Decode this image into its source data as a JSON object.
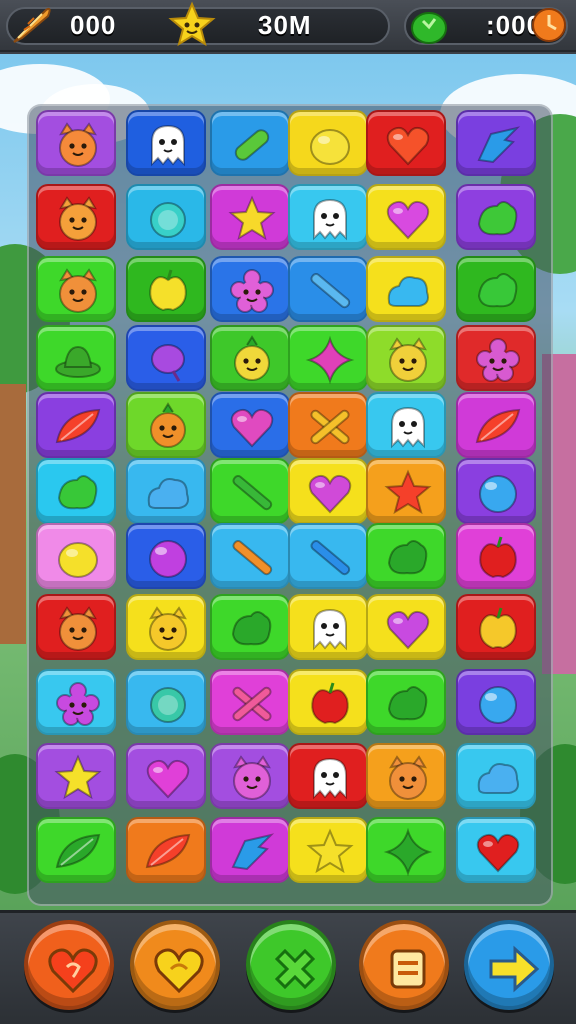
{
  "hud": {
    "left_counter": "000",
    "middle_counter": "30M",
    "right_counter": ":000",
    "icons": [
      "feather-icon",
      "star-icon",
      "green-gem-icon",
      "orange-clock-icon"
    ]
  },
  "board": {
    "rows": 11,
    "cols": 6,
    "tiles": [
      [
        {
          "bg": "#a34ee0",
          "icon": "cat-face",
          "color": "#f58a3a"
        },
        {
          "bg": "#1f5fe0",
          "icon": "ghost",
          "color": "#ffffff"
        },
        {
          "bg": "#2a9be8",
          "icon": "pickle",
          "color": "#5ac83a"
        },
        {
          "bg": "#f5d81c",
          "icon": "lemon",
          "color": "#f6e23a"
        },
        {
          "bg": "#e01f1f",
          "icon": "heart",
          "color": "#f5522a"
        },
        {
          "bg": "#7a3fe0",
          "icon": "arrow-bird",
          "color": "#2a9be8"
        }
      ],
      [
        {
          "bg": "#e01f1f",
          "icon": "cat-face",
          "color": "#f5a03a"
        },
        {
          "bg": "#2ab8e8",
          "icon": "gear-blob",
          "color": "#38d0c8"
        },
        {
          "bg": "#d03ad8",
          "icon": "star",
          "color": "#f7d92a"
        },
        {
          "bg": "#38c8ef",
          "icon": "ghost",
          "color": "#ffffff"
        },
        {
          "bg": "#f5e01c",
          "icon": "heart",
          "color": "#d84ae0"
        },
        {
          "bg": "#8e3fe0",
          "icon": "leaf-blob",
          "color": "#3ec838"
        }
      ],
      [
        {
          "bg": "#3ed82a",
          "icon": "cat-face",
          "color": "#f0903a"
        },
        {
          "bg": "#2fb81f",
          "icon": "apple",
          "color": "#f5e02a"
        },
        {
          "bg": "#2a74e8",
          "icon": "flower",
          "color": "#e060d8"
        },
        {
          "bg": "#2a8ee8",
          "icon": "stick",
          "color": "#5ab8f0"
        },
        {
          "bg": "#f5e01c",
          "icon": "cloud-blob",
          "color": "#38b8f0"
        },
        {
          "bg": "#2fb81f",
          "icon": "leaf-blob",
          "color": "#38c838"
        }
      ],
      [
        {
          "bg": "#3ed82a",
          "icon": "hat",
          "color": "#3aa82a"
        },
        {
          "bg": "#2a5ee8",
          "icon": "plum",
          "color": "#a84ae0"
        },
        {
          "bg": "#3ec82a",
          "icon": "pineapple-face",
          "color": "#f0d83a"
        },
        {
          "bg": "#3ed82a",
          "icon": "sparkle",
          "color": "#e040b8"
        },
        {
          "bg": "#8edc2a",
          "icon": "cat-face",
          "color": "#f0d03a"
        },
        {
          "bg": "#e02a2a",
          "icon": "flower",
          "color": "#d85ad0"
        }
      ],
      [
        {
          "bg": "#8a3fe0",
          "icon": "leaf",
          "color": "#f5402a"
        },
        {
          "bg": "#6ed82a",
          "icon": "pineapple-face",
          "color": "#f0902a"
        },
        {
          "bg": "#2a6ee8",
          "icon": "heart",
          "color": "#e04ac0"
        },
        {
          "bg": "#f07a1c",
          "icon": "cross-sticks",
          "color": "#f5c02a"
        },
        {
          "bg": "#38c8ef",
          "icon": "ghost",
          "color": "#ffffff"
        },
        {
          "bg": "#d03ad8",
          "icon": "leaf",
          "color": "#f5402a"
        }
      ],
      [
        {
          "bg": "#2ac8ef",
          "icon": "leaf-blob",
          "color": "#38c838"
        },
        {
          "bg": "#38b8ef",
          "icon": "cloud-blob",
          "color": "#4ab0f0"
        },
        {
          "bg": "#3ed82a",
          "icon": "stick",
          "color": "#38b838"
        },
        {
          "bg": "#f5e01c",
          "icon": "heart",
          "color": "#d04ad8"
        },
        {
          "bg": "#f5a01c",
          "icon": "star",
          "color": "#f5402a"
        },
        {
          "bg": "#8a3fe0",
          "icon": "orb",
          "color": "#38a8ef"
        }
      ],
      [
        {
          "bg": "#f08ae8",
          "icon": "lemon",
          "color": "#f5e02a"
        },
        {
          "bg": "#2a5ee8",
          "icon": "orb",
          "color": "#c040e0"
        },
        {
          "bg": "#38b8ef",
          "icon": "stick",
          "color": "#f0902a"
        },
        {
          "bg": "#38b8ef",
          "icon": "stick",
          "color": "#2a8ee8"
        },
        {
          "bg": "#3ed82a",
          "icon": "leaf-blob",
          "color": "#2aa82a"
        },
        {
          "bg": "#e040d8",
          "icon": "apple",
          "color": "#e01f1f"
        }
      ],
      [
        {
          "bg": "#e01f1f",
          "icon": "cat-face",
          "color": "#f0903a"
        },
        {
          "bg": "#f5e01c",
          "icon": "cat-face",
          "color": "#f5c82a"
        },
        {
          "bg": "#3ed82a",
          "icon": "leaf-blob",
          "color": "#2aa82a"
        },
        {
          "bg": "#f5e01c",
          "icon": "ghost",
          "color": "#ffffff"
        },
        {
          "bg": "#f5e01c",
          "icon": "heart",
          "color": "#c84ae0"
        },
        {
          "bg": "#e01f1f",
          "icon": "apple",
          "color": "#f5c82a"
        }
      ],
      [
        {
          "bg": "#38c8ef",
          "icon": "flower",
          "color": "#c84ae0"
        },
        {
          "bg": "#38b8ef",
          "icon": "gear-blob",
          "color": "#38c8a8"
        },
        {
          "bg": "#e040d8",
          "icon": "cross-sticks",
          "color": "#f05a9a"
        },
        {
          "bg": "#f5e01c",
          "icon": "apple",
          "color": "#e01f1f"
        },
        {
          "bg": "#3ed82a",
          "icon": "leaf-blob",
          "color": "#2aa82a"
        },
        {
          "bg": "#7a3fe0",
          "icon": "orb",
          "color": "#38a8ef"
        }
      ],
      [
        {
          "bg": "#a34ee0",
          "icon": "star",
          "color": "#f5e02a"
        },
        {
          "bg": "#a34ee0",
          "icon": "heart",
          "color": "#e040d8"
        },
        {
          "bg": "#a34ee0",
          "icon": "cat-face",
          "color": "#e060d8"
        },
        {
          "bg": "#e01f1f",
          "icon": "ghost",
          "color": "#ffffff"
        },
        {
          "bg": "#f5a01c",
          "icon": "cat-face",
          "color": "#f0903a"
        },
        {
          "bg": "#38c8ef",
          "icon": "cloud-blob",
          "color": "#4ab0f0"
        }
      ],
      [
        {
          "bg": "#3ed82a",
          "icon": "leaf",
          "color": "#2aa82a"
        },
        {
          "bg": "#f07a1c",
          "icon": "leaf",
          "color": "#f5402a"
        },
        {
          "bg": "#d03ad8",
          "icon": "arrow-bird",
          "color": "#2a9be8"
        },
        {
          "bg": "#f5e01c",
          "icon": "star",
          "color": "#f5e02a"
        },
        {
          "bg": "#3ed82a",
          "icon": "sparkle",
          "color": "#2aa82a"
        },
        {
          "bg": "#38c8ef",
          "icon": "heart",
          "color": "#e01f1f"
        }
      ]
    ]
  },
  "bottom_buttons": [
    {
      "name": "heart-button",
      "icon": "heart-icon",
      "color": "#f0601c"
    },
    {
      "name": "heart-refresh-button",
      "icon": "heart-refresh-icon",
      "color": "#f08a1c"
    },
    {
      "name": "cross-button",
      "icon": "cross-icon",
      "color": "#3ec82a"
    },
    {
      "name": "menu-button",
      "icon": "menu-icon",
      "color": "#f07a1c"
    },
    {
      "name": "next-arrow-button",
      "icon": "arrow-right-icon",
      "color": "#2a9be8"
    }
  ]
}
